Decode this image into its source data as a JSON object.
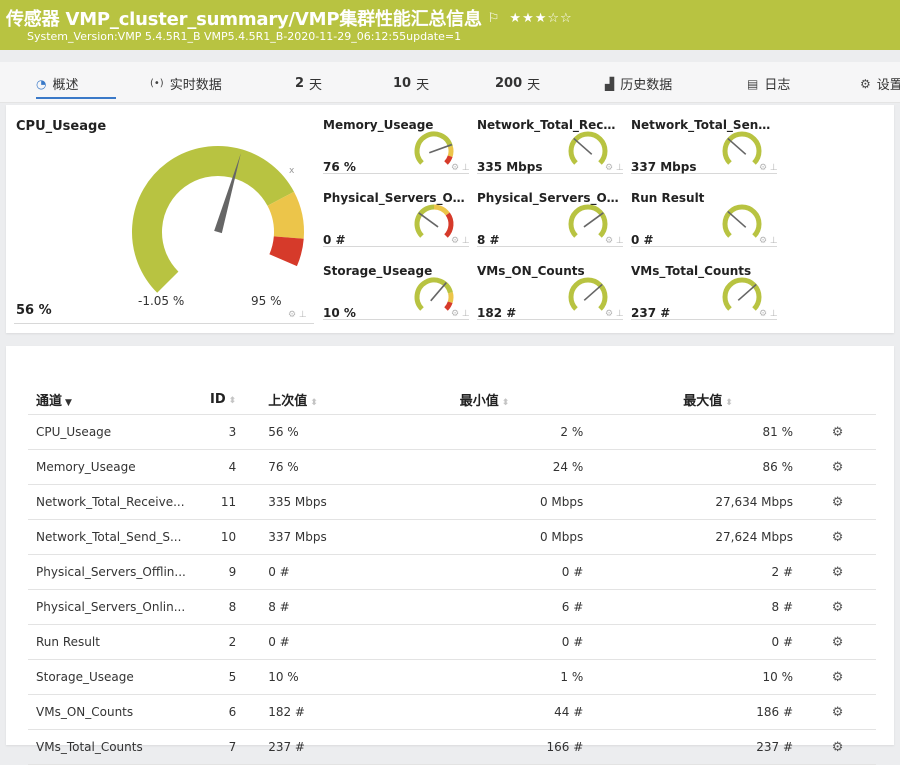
{
  "header": {
    "title": "传感器 VMP_cluster_summary/VMP集群性能汇总信息",
    "flag_icon": "flag-icon",
    "stars": "★★★☆☆",
    "rating": 3,
    "subtitle": "System_Version:VMP 5.4.5R1_B VMP5.4.5R1_B-2020-11-29_06:12:55update=1",
    "color": "#b8c341"
  },
  "tabs": [
    {
      "label": "概述",
      "icon": "gauge-icon",
      "active": true
    },
    {
      "label": "实时数据",
      "icon": "live-signal-icon"
    },
    {
      "num": "2",
      "label": "天"
    },
    {
      "num": "10",
      "label": "天"
    },
    {
      "num": "200",
      "label": "天"
    },
    {
      "label": "历史数据",
      "icon": "area-chart-icon"
    },
    {
      "label": "日志",
      "icon": "log-icon"
    },
    {
      "label": "设置",
      "icon": "gear-icon"
    }
  ],
  "big_gauge": {
    "title": "CPU_Useage",
    "value_text": "56 %",
    "value": 56,
    "min_text": "-1.05 %",
    "max_text": "95 %",
    "close_mark": "x"
  },
  "mini_gauges": [
    {
      "name": "Memory_Useage",
      "value_text": "76 %",
      "value": 76,
      "style": "warn"
    },
    {
      "name": "Network_Total_Received",
      "value_text": "335 Mbps",
      "value": 32,
      "style": "plain"
    },
    {
      "name": "Network_Total_Send_Speed",
      "value_text": "337 Mbps",
      "value": 32,
      "style": "plain"
    },
    {
      "name": "Physical_Servers_Offline",
      "value_text": "0 #",
      "value": 30,
      "style": "alarm"
    },
    {
      "name": "Physical_Servers_Online",
      "value_text": "8 #",
      "value": 70,
      "style": "plain"
    },
    {
      "name": "Run Result",
      "value_text": "0 #",
      "value": 32,
      "style": "plain"
    },
    {
      "name": "Storage_Useage",
      "value_text": "10 %",
      "value": 65,
      "style": "warn"
    },
    {
      "name": "VMs_ON_Counts",
      "value_text": "182 #",
      "value": 68,
      "style": "plain"
    },
    {
      "name": "VMs_Total_Counts",
      "value_text": "237 #",
      "value": 68,
      "style": "plain"
    }
  ],
  "table": {
    "headers": {
      "channel": "通道",
      "id": "ID",
      "last": "上次值",
      "min": "最小值",
      "max": "最大值"
    },
    "rows": [
      {
        "channel": "CPU_Useage",
        "id": "3",
        "last": "56 %",
        "min": "2 %",
        "max": "81 %"
      },
      {
        "channel": "Memory_Useage",
        "id": "4",
        "last": "76 %",
        "min": "24 %",
        "max": "86 %"
      },
      {
        "channel": "Network_Total_Receive...",
        "id": "11",
        "last": "335 Mbps",
        "min": "0 Mbps",
        "max": "27,634 Mbps"
      },
      {
        "channel": "Network_Total_Send_S...",
        "id": "10",
        "last": "337 Mbps",
        "min": "0 Mbps",
        "max": "27,624 Mbps"
      },
      {
        "channel": "Physical_Servers_Offlin...",
        "id": "9",
        "last": "0 #",
        "min": "0 #",
        "max": "2 #"
      },
      {
        "channel": "Physical_Servers_Onlin...",
        "id": "8",
        "last": "8 #",
        "min": "6 #",
        "max": "8 #"
      },
      {
        "channel": "Run Result",
        "id": "2",
        "last": "0 #",
        "min": "0 #",
        "max": "0 #"
      },
      {
        "channel": "Storage_Useage",
        "id": "5",
        "last": "10 %",
        "min": "1 %",
        "max": "10 %"
      },
      {
        "channel": "VMs_ON_Counts",
        "id": "6",
        "last": "182 #",
        "min": "44 #",
        "max": "186 #"
      },
      {
        "channel": "VMs_Total_Counts",
        "id": "7",
        "last": "237 #",
        "min": "166 #",
        "max": "237 #"
      }
    ]
  },
  "colors": {
    "gauge_green": "#b8c341",
    "gauge_yellow": "#ecc54a",
    "gauge_red": "#d63a2a",
    "needle": "#666666"
  }
}
